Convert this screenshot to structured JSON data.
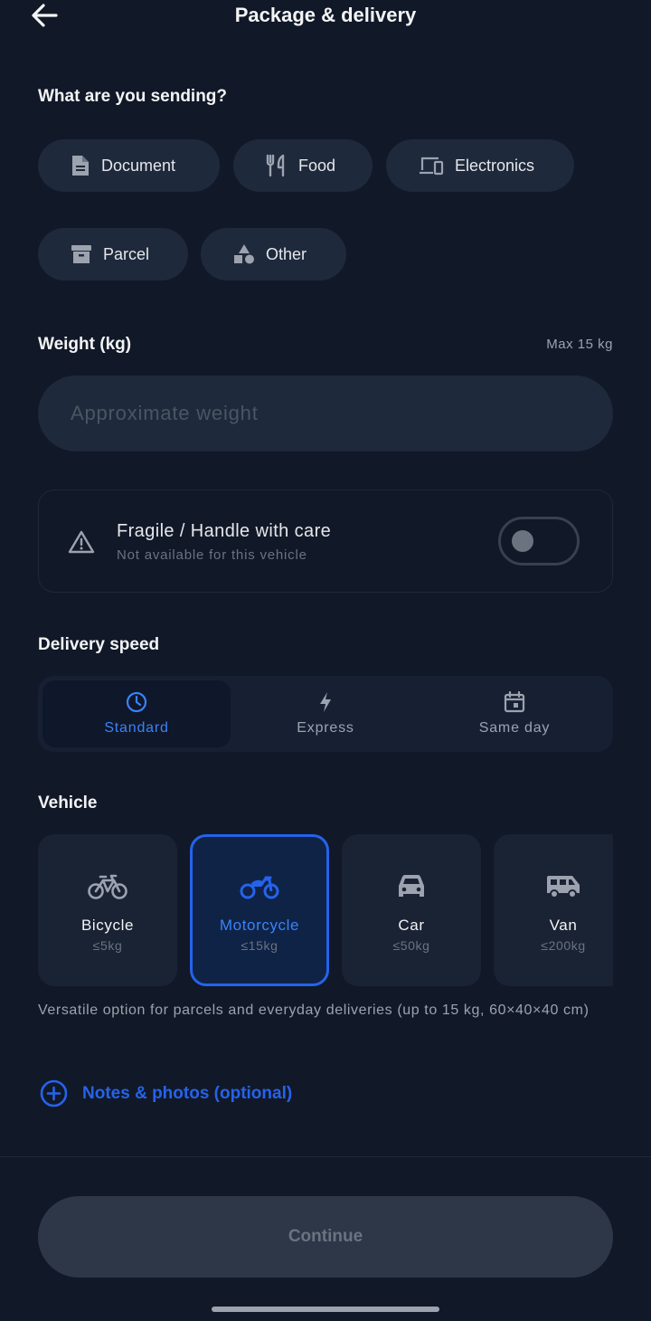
{
  "header": {
    "title": "Package & delivery"
  },
  "sending": {
    "label": "What are you sending?",
    "options": [
      {
        "label": "Document",
        "icon": "document-icon"
      },
      {
        "label": "Food",
        "icon": "utensils-icon"
      },
      {
        "label": "Electronics",
        "icon": "devices-icon"
      },
      {
        "label": "Parcel",
        "icon": "archive-box-icon"
      },
      {
        "label": "Other",
        "icon": "shapes-icon"
      }
    ]
  },
  "weight": {
    "label": "Weight (kg)",
    "max": "Max 15 kg",
    "value": "",
    "placeholder": "Approximate weight"
  },
  "fragile": {
    "title": "Fragile / Handle with care",
    "subtitle": "Not available for this vehicle",
    "icon": "warning-icon",
    "enabled": false
  },
  "speed": {
    "label": "Delivery speed",
    "selected": "Standard",
    "options": [
      {
        "label": "Standard",
        "icon": "clock-icon"
      },
      {
        "label": "Express",
        "icon": "lightning-icon"
      },
      {
        "label": "Same day",
        "icon": "calendar-icon"
      }
    ]
  },
  "vehicle": {
    "label": "Vehicle",
    "selected": "Motorcycle",
    "options": [
      {
        "name": "Bicycle",
        "capacity": "≤5kg",
        "icon": "bicycle-icon"
      },
      {
        "name": "Motorcycle",
        "capacity": "≤15kg",
        "icon": "motorcycle-icon"
      },
      {
        "name": "Car",
        "capacity": "≤50kg",
        "icon": "car-icon"
      },
      {
        "name": "Van",
        "capacity": "≤200kg",
        "icon": "van-icon"
      }
    ],
    "description": "Versatile option for parcels and everyday deliveries (up to 15 kg, 60×40×40 cm)"
  },
  "notes": {
    "label": "Notes & photos (optional)",
    "icon": "plus-circle-icon"
  },
  "footer": {
    "continue_label": "Continue"
  },
  "colors": {
    "background": "#111827",
    "surface": "#1e293b",
    "accent": "#2563eb",
    "accent_text": "#3b82f6",
    "muted_text": "#9ca3af"
  }
}
